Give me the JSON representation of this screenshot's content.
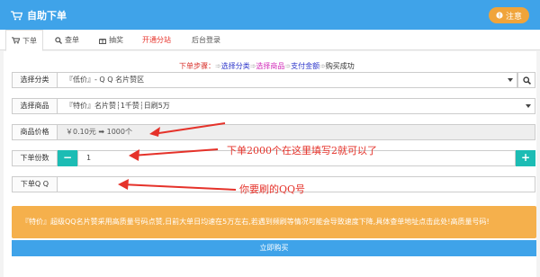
{
  "header": {
    "title": "自助下单",
    "notice_label": "注意"
  },
  "tabs": [
    {
      "label": "下单",
      "icon": "cart-icon"
    },
    {
      "label": "查单",
      "icon": "search-icon"
    },
    {
      "label": "抽奖",
      "icon": "gift-icon"
    },
    {
      "label": "开通分站"
    },
    {
      "label": "后台登录"
    }
  ],
  "steps": {
    "prefix": "下单步骤：",
    "step1": "选择分类",
    "step2": "选择商品",
    "step3": "支付金额",
    "step4": "购买成功",
    "separator": "➾"
  },
  "form": {
    "category": {
      "label": "选择分类",
      "value": "『低价』- Q Q 名片赞区"
    },
    "product": {
      "label": "选择商品",
      "value": "『特价』名片赞┆1千赞┆日刷5万"
    },
    "price": {
      "label": "商品价格",
      "value": "￥0.10元 ➡ 1000个"
    },
    "quantity": {
      "label": "下单份数",
      "value": "1",
      "minus": "−",
      "plus": "+"
    },
    "qq": {
      "label": "下单Q Q",
      "value": ""
    }
  },
  "annotations": {
    "quantity_note": "下单2000个在这里填写2就可以了",
    "qq_note": "你要刷的QQ号"
  },
  "warning_text": "『特价』超级QQ名片赞采用高质量号码点赞,日前大单日均速在5万左右,若遇到频刷等情况可能会导致速度下降,具体查单地址点击此处!高质量号码!",
  "buy_label": "立即购买",
  "colors": {
    "primary": "#3fa3e9",
    "warning": "#f5b04c",
    "stepper": "#1cbcb4",
    "annotation": "#e5322a"
  }
}
